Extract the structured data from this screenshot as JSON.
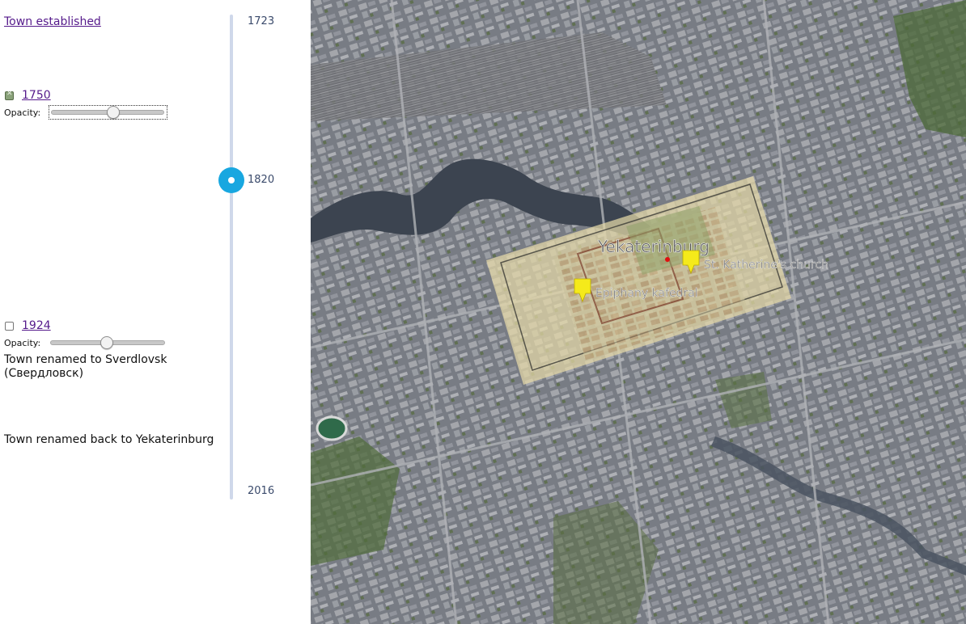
{
  "timeline": {
    "start_label": "1723",
    "current_label": "1820",
    "end_label": "2016",
    "events": [
      {
        "label": "Town established"
      },
      {
        "label": "1750",
        "checked": true,
        "opacity_label": "Opacity:",
        "opacity_value": 0.56
      },
      {
        "label": "1924",
        "checked": false,
        "opacity_label": "Opacity:",
        "opacity_value": 0.5
      },
      {
        "text": "Town renamed to Sverdlovsk (Свердловск)"
      },
      {
        "text": "Town renamed back to Yekaterinburg"
      }
    ]
  },
  "map": {
    "city_label": "Yekaterinburg",
    "markers": [
      {
        "label": "St. Katherine's church",
        "color": "#f5ea1a"
      },
      {
        "label": "Epiphany kafedral",
        "color": "#f5ea1a"
      }
    ],
    "colors": {
      "water": "#3c4450",
      "overlay": "#e6d9a8",
      "timeline_handle": "#18a7e0",
      "link": "#551a8b"
    }
  }
}
